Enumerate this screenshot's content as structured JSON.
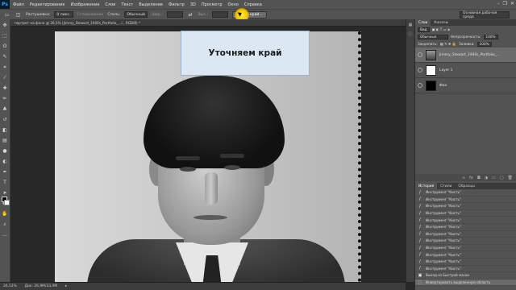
{
  "app": {
    "logo": "Ps"
  },
  "menu": [
    "Файл",
    "Редактирование",
    "Изображение",
    "Слои",
    "Текст",
    "Выделение",
    "Фильтр",
    "3D",
    "Просмотр",
    "Окно",
    "Справка"
  ],
  "window_controls": [
    "–",
    "❐",
    "✕"
  ],
  "options": {
    "feather_label": "Растушевка:",
    "feather_value": "0 пикс.",
    "antialias_label": "Сглаживание",
    "style_label": "Стиль:",
    "style_value": "Обычный",
    "width_label": "Шир.:",
    "height_label": "Выс.:",
    "refine_button": "Уточн. край...",
    "workspace_value": "Основная рабочая среда"
  },
  "document_tab": "портрет на фоне @ 26,5% (Jimmy_Stewart_1940s_Portfolio_...) , RGB/8) *",
  "callout_text": "Уточняем край",
  "status": {
    "zoom": "26,53%",
    "doc": "Док: 26,9М/33,4М"
  },
  "panel": {
    "tabs": [
      "Слои",
      "Каналы"
    ],
    "kind_label": "Вид",
    "blend_mode": "Обычные",
    "opacity_label": "Непрозрачность:",
    "opacity_value": "100%",
    "lock_label": "Закрепить:",
    "fill_label": "Заливка:",
    "fill_value": "100%",
    "layers": [
      {
        "name": "Jimmy_Stewart_1940s_Portfolio_..."
      },
      {
        "name": "Layer 1"
      },
      {
        "name": "Фон"
      }
    ]
  },
  "history": {
    "tabs": [
      "История",
      "Стили",
      "Образцы"
    ],
    "items": [
      "Инструмент \"Кисть\"",
      "Инструмент \"Кисть\"",
      "Инструмент \"Кисть\"",
      "Инструмент \"Кисть\"",
      "Инструмент \"Кисть\"",
      "Инструмент \"Кисть\"",
      "Инструмент \"Кисть\"",
      "Инструмент \"Кисть\"",
      "Инструмент \"Кисть\"",
      "Инструмент \"Кисть\"",
      "Инструмент \"Кисть\"",
      "Инструмент \"Кисть\"",
      "Выход из Быстрой маски",
      "Инвертировать выделенную область"
    ]
  },
  "colors": {
    "chrome": "#535353",
    "dark": "#282828",
    "callout_bg": "#dce7f4",
    "cursor": "#f1c400"
  }
}
